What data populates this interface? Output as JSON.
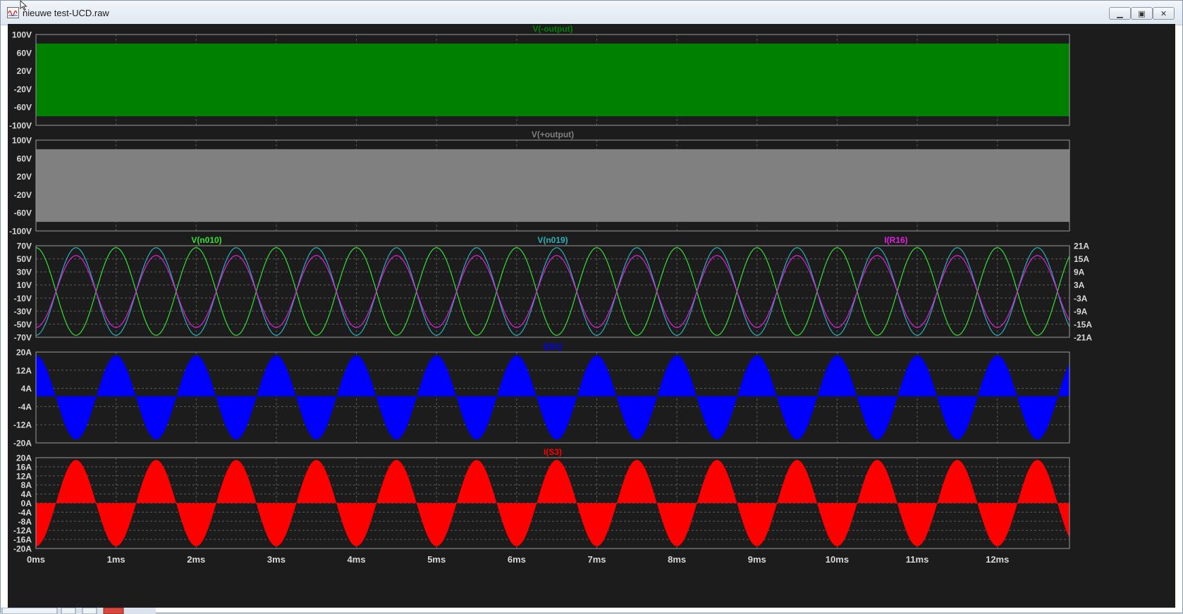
{
  "window": {
    "title": "nieuwe test-UCD.raw"
  },
  "window_buttons": {
    "minimize_icon": "minimize-icon",
    "maximize_icon": "maximize-icon",
    "close_icon": "close-icon"
  },
  "colors": {
    "background": "#1c1c1c",
    "grid": "#5a5a5a",
    "frame": "#9a9a9a",
    "axis_text": "#d8d8d8",
    "v_minus_output": "#008000",
    "v_plus_output": "#808080",
    "v_n010": "#33e033",
    "v_n019": "#2ab0b8",
    "i_r16": "#e020e0",
    "i_s1": "#0000ff",
    "i_s3": "#ff0000"
  },
  "x_axis": {
    "ticks": [
      "0ms",
      "1ms",
      "2ms",
      "3ms",
      "4ms",
      "5ms",
      "6ms",
      "7ms",
      "8ms",
      "9ms",
      "10ms",
      "11ms",
      "12ms"
    ]
  },
  "chart_data": [
    {
      "type": "area",
      "title": "V(-output)",
      "series": [
        {
          "name": "V(-output)",
          "envelope_min": -80,
          "envelope_max": 80
        }
      ],
      "xlim": [
        0,
        12.9
      ],
      "xunit": "ms",
      "ylim": [
        -100,
        100
      ],
      "yticks": [
        "100V",
        "60V",
        "20V",
        "-20V",
        "-60V",
        "-100V"
      ],
      "grid": true
    },
    {
      "type": "area",
      "title": "V(+output)",
      "series": [
        {
          "name": "V(+output)",
          "envelope_min": -80,
          "envelope_max": 80
        }
      ],
      "xlim": [
        0,
        12.9
      ],
      "xunit": "ms",
      "ylim": [
        -100,
        100
      ],
      "yticks": [
        "100V",
        "60V",
        "20V",
        "-20V",
        "-60V",
        "-100V"
      ],
      "grid": true
    },
    {
      "type": "line",
      "title_left": "V(n010)",
      "title_center": "V(n019)",
      "title_right": "I(R16)",
      "series": [
        {
          "name": "V(n010)",
          "axis": "left",
          "amplitude": 67,
          "frequency_khz": 1,
          "phase_deg": 90
        },
        {
          "name": "V(n019)",
          "axis": "left",
          "amplitude": 67,
          "frequency_khz": 1,
          "phase_deg": -90
        },
        {
          "name": "I(R16)",
          "axis": "right",
          "amplitude": 16.5,
          "frequency_khz": 1,
          "phase_deg": -90
        }
      ],
      "xlim": [
        0,
        12.9
      ],
      "xunit": "ms",
      "ylim_left": [
        -70,
        70
      ],
      "ylim_right": [
        -21,
        21
      ],
      "yticks_left": [
        "70V",
        "50V",
        "30V",
        "10V",
        "-10V",
        "-30V",
        "-50V",
        "-70V"
      ],
      "yticks_right": [
        "21A",
        "15A",
        "9A",
        "3A",
        "-3A",
        "-9A",
        "-15A",
        "-21A"
      ],
      "grid": true
    },
    {
      "type": "area",
      "title": "I(S1)",
      "series": [
        {
          "name": "I(S1)",
          "amplitude": 18.5,
          "frequency_khz": 1,
          "phase_deg": 90
        }
      ],
      "xlim": [
        0,
        12.9
      ],
      "xunit": "ms",
      "ylim": [
        -20,
        20
      ],
      "yticks": [
        "20A",
        "12A",
        "4A",
        "-4A",
        "-12A",
        "-20A"
      ],
      "grid": true
    },
    {
      "type": "area",
      "title": "I(S3)",
      "series": [
        {
          "name": "I(S3)",
          "amplitude": 19,
          "frequency_khz": 1,
          "phase_deg": -90
        }
      ],
      "xlim": [
        0,
        12.9
      ],
      "xunit": "ms",
      "ylim": [
        -20,
        20
      ],
      "yticks": [
        "20A",
        "16A",
        "12A",
        "8A",
        "4A",
        "0A",
        "-4A",
        "-8A",
        "-12A",
        "-16A",
        "-20A"
      ],
      "grid": true
    }
  ]
}
